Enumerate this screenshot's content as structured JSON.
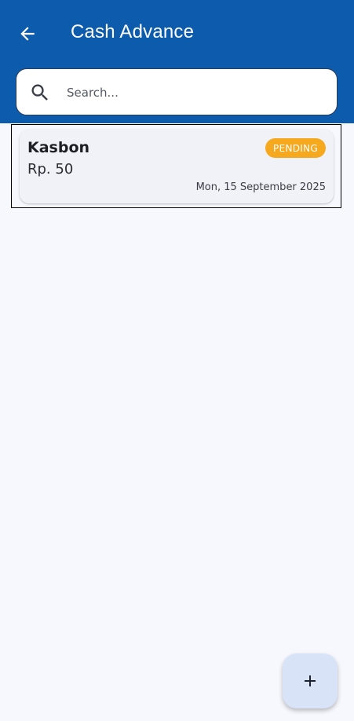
{
  "appbar": {
    "title": "Cash Advance",
    "back_icon": "arrow-left-icon",
    "color": "#0d5bad"
  },
  "search": {
    "placeholder": "Search...",
    "value": "",
    "icon": "search-icon"
  },
  "items": [
    {
      "title": "Kasbon",
      "amount": "Rp. 50",
      "status": "PENDING",
      "status_color": "#f6a91f",
      "date": "Mon, 15 September 2025"
    }
  ],
  "fab": {
    "icon": "plus-icon",
    "background": "#d8e3f8"
  }
}
